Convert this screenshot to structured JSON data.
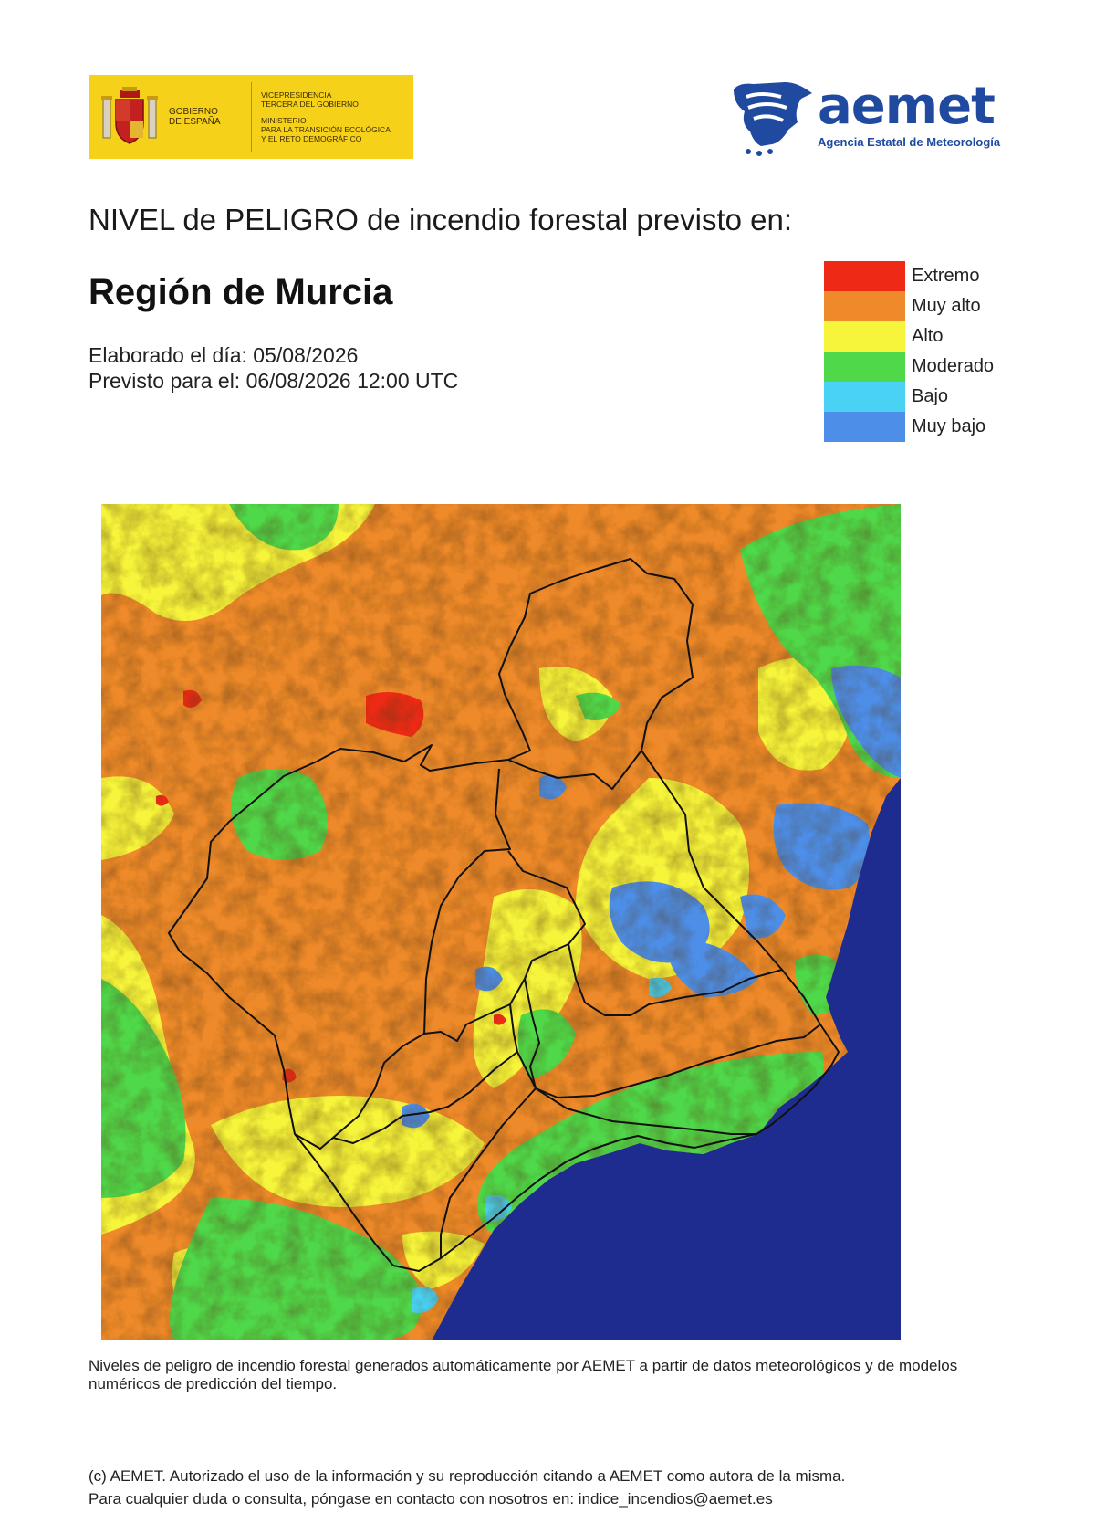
{
  "logos": {
    "government": {
      "left_text": [
        "GOBIERNO",
        "DE ESPAÑA"
      ],
      "right_text": [
        "VICEPRESIDENCIA",
        "TERCERA DEL GOBIERNO",
        "MINISTERIO",
        "PARA LA TRANSICIÓN ECOLÓGICA",
        "Y EL RETO DEMOGRÁFICO"
      ],
      "background_color": "#f6d11a"
    },
    "aemet": {
      "wordmark": "aemet",
      "subtitle": "Agencia Estatal de Meteorología",
      "color": "#1f4aa0"
    }
  },
  "header": {
    "title": "NIVEL de PELIGRO de incendio forestal previsto en:",
    "region": "Región de Murcia",
    "made_on": "Elaborado el día: 05/08/2026",
    "valid_for": "Previsto para el: 06/08/2026 12:00 UTC"
  },
  "legend": [
    {
      "label": "Extremo",
      "color": "#ee2a16"
    },
    {
      "label": "Muy alto",
      "color": "#ef8a2a"
    },
    {
      "label": "Alto",
      "color": "#f6f43b"
    },
    {
      "label": "Moderado",
      "color": "#4fd94a"
    },
    {
      "label": "Bajo",
      "color": "#49d2f3"
    },
    {
      "label": "Muy bajo",
      "color": "#4d8ee8"
    }
  ],
  "map": {
    "sea_color": "#1f2c8f",
    "border_color": "#111111"
  },
  "footer": {
    "note": "Niveles de peligro de incendio forestal generados automáticamente por AEMET a partir de datos meteorológicos y de modelos numéricos de predicción del tiempo.",
    "copyright": "(c) AEMET. Autorizado el uso de la información y su reproducción citando a AEMET como autora de la misma.",
    "contact": "Para cualquier duda o consulta, póngase en contacto con nosotros en: indice_incendios@aemet.es"
  }
}
